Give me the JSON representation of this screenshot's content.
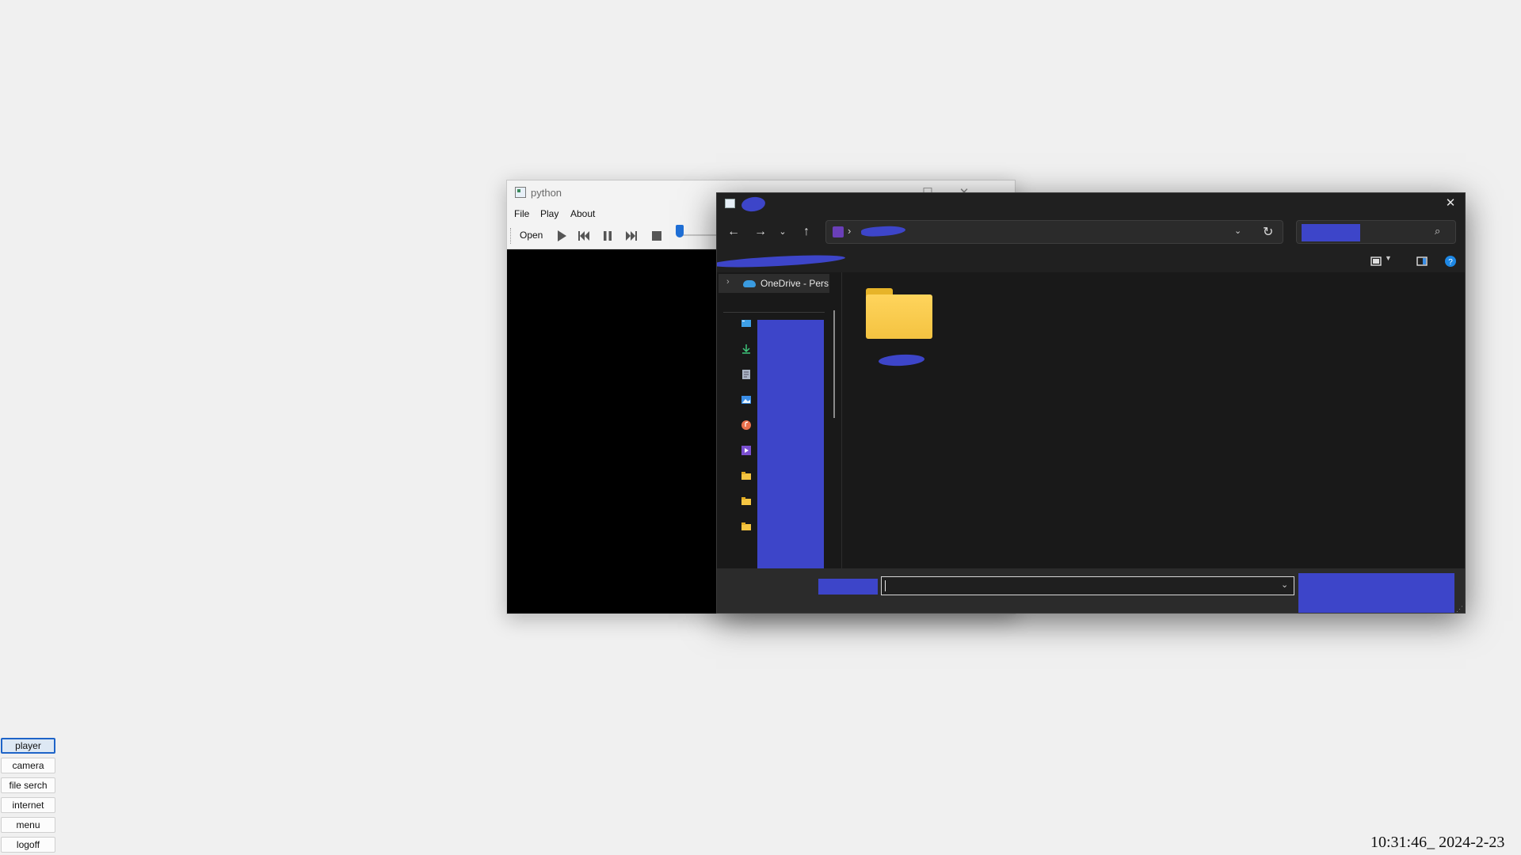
{
  "player_window": {
    "title": "python",
    "menu": [
      "File",
      "Play",
      "About"
    ],
    "toolbar": {
      "open_label": "Open",
      "buttons": [
        "play-icon",
        "skip-back-icon",
        "pause-icon",
        "skip-forward-icon",
        "stop-icon"
      ]
    },
    "window_controls": [
      "minimize-icon",
      "maximize-icon",
      "close-icon"
    ]
  },
  "file_dialog": {
    "nav_pane": {
      "onedrive_label": "OneDrive - Pers",
      "quick_access_icons": [
        "desktop-icon",
        "downloads-icon",
        "documents-icon",
        "pictures-icon",
        "music-icon",
        "videos-icon",
        "folder-icon",
        "folder-icon",
        "folder-icon"
      ]
    },
    "close_glyph": "✕",
    "accent_color": "#3d45c9"
  },
  "launcher": {
    "buttons": [
      "player",
      "camera",
      "file serch",
      "internet",
      "menu",
      "logoff"
    ],
    "active": "player"
  },
  "clock": "10:31:46_ 2024-2-23"
}
